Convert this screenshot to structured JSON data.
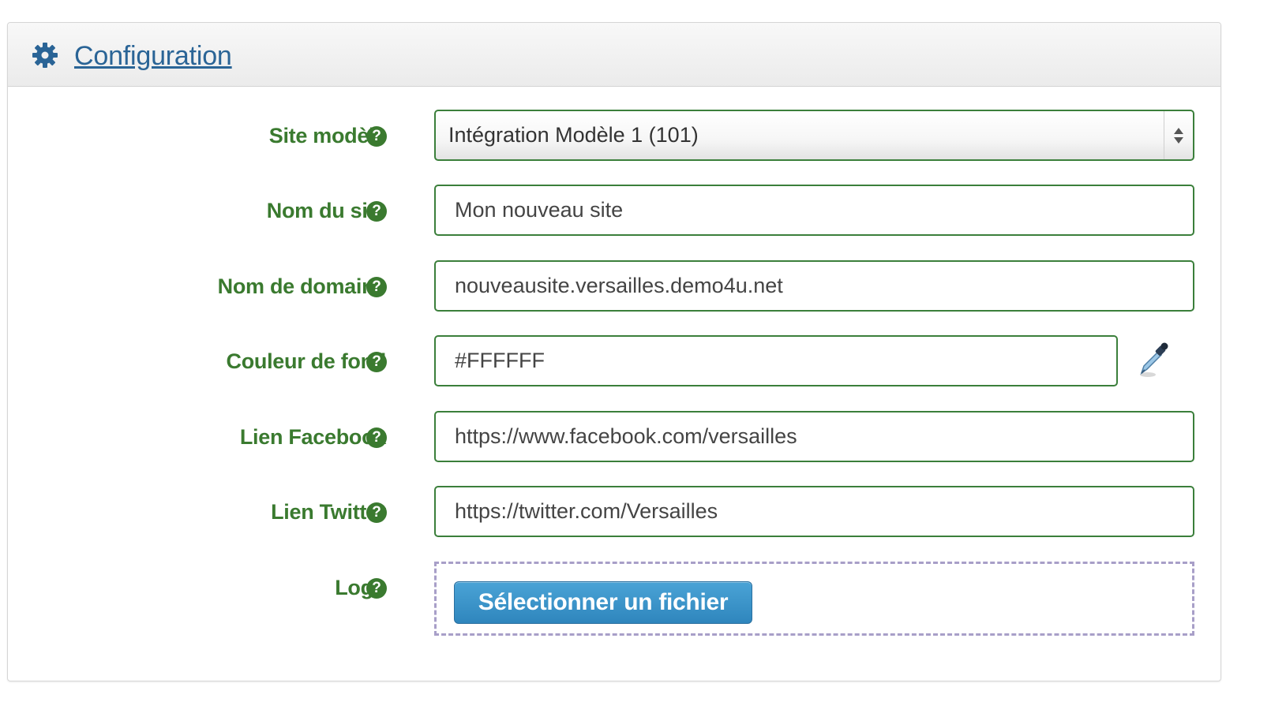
{
  "panel": {
    "title": "Configuration",
    "title_icon": "gear-icon"
  },
  "form": {
    "help_glyph": "?",
    "site_modele": {
      "label": "Site modèle",
      "value": "Intégration Modèle 1 (101)"
    },
    "nom_du_site": {
      "label": "Nom du site",
      "value": "Mon nouveau site"
    },
    "nom_de_domaine": {
      "label": "Nom de domaine",
      "value": "nouveausite.versailles.demo4u.net"
    },
    "couleur_de_fond": {
      "label": "Couleur de fond",
      "value": "#FFFFFF",
      "picker_icon": "eyedropper-icon"
    },
    "lien_facebook": {
      "label": "Lien Facebook",
      "value": "https://www.facebook.com/versailles"
    },
    "lien_twitter": {
      "label": "Lien Twitter",
      "value": "https://twitter.com/Versailles"
    },
    "logo": {
      "label": "Logo",
      "button_label": "Sélectionner un fichier"
    }
  },
  "colors": {
    "label_green": "#3a7a2f",
    "field_border": "#3b7f3b",
    "link_blue": "#2a6496",
    "button_blue": "#3a93c9",
    "dropzone_border": "#a89fc8"
  }
}
